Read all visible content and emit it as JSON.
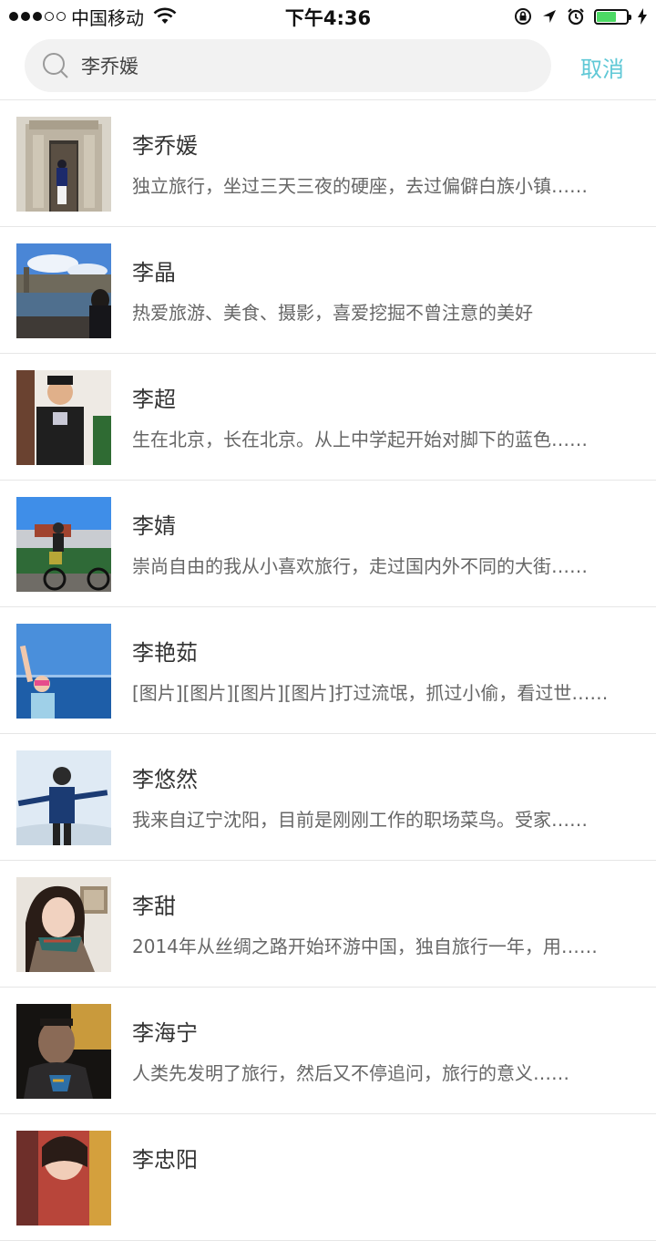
{
  "status_bar": {
    "carrier": "中国移动",
    "time": "下午4:36",
    "battery_level": 0.65,
    "signal_bars": 3
  },
  "search": {
    "query": "李乔媛",
    "cancel_label": "取消"
  },
  "colors": {
    "accent": "#5fc8d6",
    "battery": "#4cd964"
  },
  "results": [
    {
      "name": "李乔媛",
      "bio": "独立旅行，坐过三天三夜的硬座，去过偏僻白族小镇……"
    },
    {
      "name": "李晶",
      "bio": "热爱旅游、美食、摄影，喜爱挖掘不曾注意的美好"
    },
    {
      "name": "李超",
      "bio": "生在北京，长在北京。从上中学起开始对脚下的蓝色……"
    },
    {
      "name": "李婧",
      "bio": "崇尚自由的我从小喜欢旅行，走过国内外不同的大街……"
    },
    {
      "name": "李艳茹",
      "bio": "[图片][图片][图片][图片]打过流氓，抓过小偷，看过世……"
    },
    {
      "name": "李悠然",
      "bio": "我来自辽宁沈阳，目前是刚刚工作的职场菜鸟。受家……"
    },
    {
      "name": "李甜",
      "bio": "2014年从丝绸之路开始环游中国，独自旅行一年，用……"
    },
    {
      "name": "李海宁",
      "bio": "人类先发明了旅行，然后又不停追问，旅行的意义……"
    },
    {
      "name": "李忠阳",
      "bio": ""
    }
  ]
}
